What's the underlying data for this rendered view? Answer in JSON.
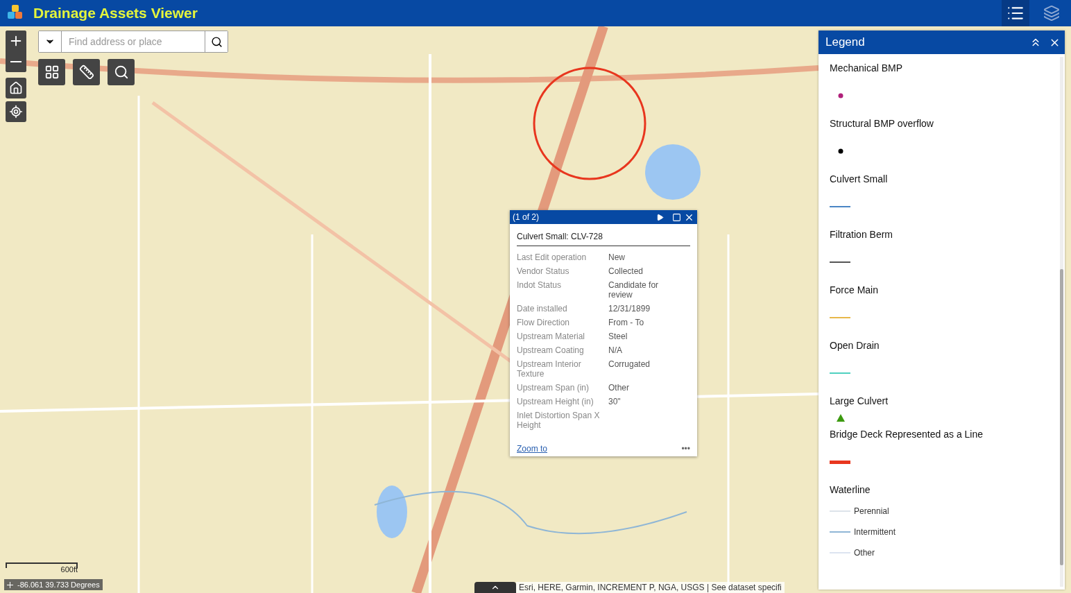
{
  "header": {
    "title": "Drainage Assets Viewer"
  },
  "search": {
    "placeholder": "Find address or place"
  },
  "popup": {
    "counter": "(1 of 2)",
    "title": "Culvert Small: CLV-728",
    "fields": [
      {
        "label": "Last Edit operation",
        "value": "New"
      },
      {
        "label": "Vendor Status",
        "value": "Collected"
      },
      {
        "label": "Indot Status",
        "value": "Candidate for review"
      },
      {
        "label": "Date installed",
        "value": "12/31/1899"
      },
      {
        "label": "Flow Direction",
        "value": "From - To"
      },
      {
        "label": "Upstream Material",
        "value": "Steel"
      },
      {
        "label": "Upstream Coating",
        "value": "N/A"
      },
      {
        "label": "Upstream Interior Texture",
        "value": "Corrugated"
      },
      {
        "label": "Upstream Span (in)",
        "value": "Other"
      },
      {
        "label": "Upstream Height (in)",
        "value": "30\""
      },
      {
        "label": "Inlet Distortion Span X Height"
      }
    ],
    "link": "Zoom to",
    "more": "•••"
  },
  "legend": {
    "title": "Legend",
    "items": [
      {
        "label": "Mechanical BMP",
        "kind": "point",
        "color": "#b0207a"
      },
      {
        "label": "Structural BMP overflow",
        "kind": "point",
        "color": "#000000"
      },
      {
        "label": "Culvert Small",
        "kind": "line",
        "color": "#4a86c5"
      },
      {
        "label": "Filtration Berm",
        "kind": "line",
        "color": "#555555"
      },
      {
        "label": "Force Main",
        "kind": "line",
        "color": "#e8b84a"
      },
      {
        "label": "Open Drain",
        "kind": "line",
        "color": "#4fd0c0"
      },
      {
        "label": "Large Culvert",
        "kind": "triangle",
        "color": "#3c9a10"
      },
      {
        "label": "Bridge Deck Represented as a Line",
        "kind": "thick",
        "color": "#e8361e"
      },
      {
        "label": "Waterline",
        "kind": "group",
        "children": [
          {
            "label": "Perennial",
            "color": "#dde3ea"
          },
          {
            "label": "Intermittent",
            "color": "#8fb6d6"
          },
          {
            "label": "Other",
            "color": "#dce4f0"
          }
        ]
      }
    ]
  },
  "scale": {
    "label": "600ft"
  },
  "coordinates": "-86.061 39.733 Degrees",
  "attribution": "Esri, HERE, Garmin, INCREMENT P, NGA, USGS | See dataset specifi"
}
